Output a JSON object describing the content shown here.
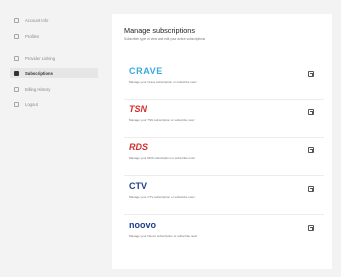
{
  "sidebar": {
    "items": [
      {
        "label": "Account Info",
        "icon": "home-icon"
      },
      {
        "label": "Profiles",
        "icon": "profiles-icon"
      },
      {
        "label": "Provider Linking",
        "icon": "link-icon"
      },
      {
        "label": "Subscriptions",
        "icon": "subscriptions-icon"
      },
      {
        "label": "Billing History",
        "icon": "billing-icon"
      },
      {
        "label": "Logout",
        "icon": "logout-icon"
      }
    ],
    "active": "Subscriptions"
  },
  "panel": {
    "title": "Manage subscriptions",
    "subtitle": "Subscriber type or view and edit your active subscriptions",
    "subscriptions": [
      {
        "brand": "CRAVE",
        "description": "Manage your Crave subscription or subscribe now!",
        "color": "#39a9dc"
      },
      {
        "brand": "TSN",
        "description": "Manage your TSN subscription or subscribe now!",
        "color": "#d42e2e"
      },
      {
        "brand": "RDS",
        "description": "Manage your RDS subscription or subscribe now!",
        "color": "#d42e2e"
      },
      {
        "brand": "CTV",
        "description": "Manage your CTV subscription or subscribe now!",
        "color": "#1d3f8a"
      },
      {
        "brand": "noovo",
        "description": "Manage your Noovo subscription or subscribe now!",
        "color": "#1d3f8a"
      }
    ]
  }
}
